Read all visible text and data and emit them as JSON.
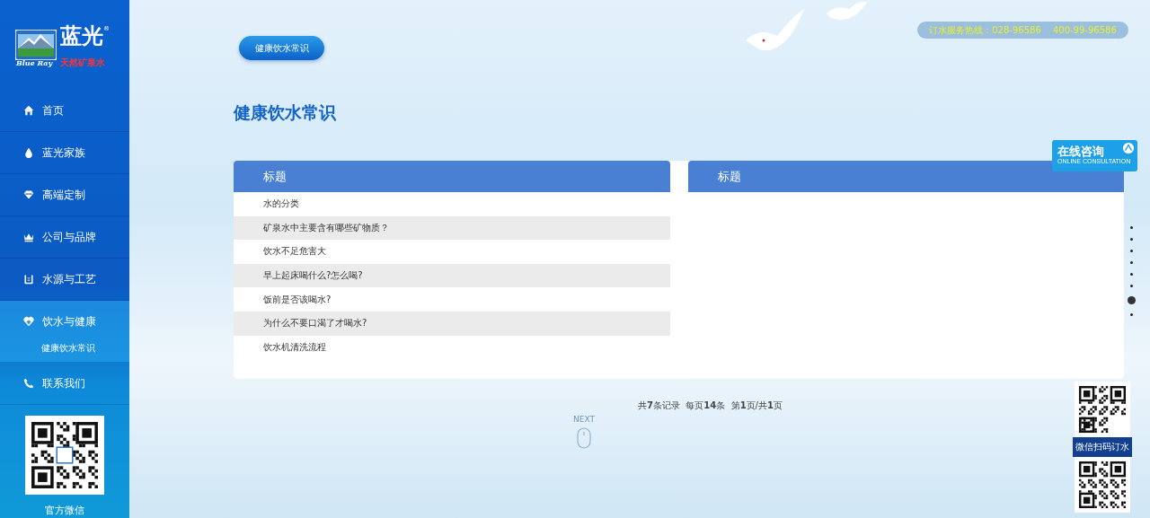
{
  "logo": {
    "brand": "蓝光",
    "brand_en": "Blue Ray",
    "tagline": "天然矿泉水",
    "registered": "®"
  },
  "sidebar": {
    "items": [
      {
        "label": "首页",
        "kind": "home",
        "selected": false
      },
      {
        "label": "蓝光家族",
        "kind": "drop",
        "selected": false
      },
      {
        "label": "高端定制",
        "kind": "diamond",
        "selected": false
      },
      {
        "label": "公司与品牌",
        "kind": "crown",
        "selected": false
      },
      {
        "label": "水源与工艺",
        "kind": "building",
        "selected": false
      },
      {
        "label": "饮水与健康",
        "kind": "heart",
        "selected": true,
        "children": [
          {
            "label": "健康饮水常识"
          }
        ]
      },
      {
        "label": "联系我们",
        "kind": "phone",
        "selected": false
      }
    ],
    "qr_caption": "官方微信"
  },
  "hotline": "订水服务热线：028-96586　 400-99-96586",
  "breadcrumb_button": "健康饮水常识",
  "page_title": "健康饮水常识",
  "list_panel": {
    "heading": "标题",
    "rows": [
      {
        "title": "水的分类"
      },
      {
        "title": "矿泉水中主要含有哪些矿物质？"
      },
      {
        "title": "饮水不足危害大"
      },
      {
        "title": "早上起床喝什么?怎么喝?"
      },
      {
        "title": "饭前是否该喝水?"
      },
      {
        "title": "为什么不要口渴了才喝水?"
      },
      {
        "title": "饮水机清洗流程"
      }
    ]
  },
  "detail_panel": {
    "heading": "标题"
  },
  "pagination": "共**7**条记录  每页**14**条  第**1**页/共**1**页",
  "scroll_hint": "NEXT",
  "online_consult": {
    "title": "在线咨询",
    "subtitle": "ONLINE CONSULTATION"
  },
  "page_dots": [
    {
      "selected": false
    },
    {
      "selected": false
    },
    {
      "selected": false
    },
    {
      "selected": false
    },
    {
      "selected": false
    },
    {
      "selected": false
    },
    {
      "selected": true
    },
    {
      "selected": false
    }
  ],
  "order_qr_caption": "微信扫码订水"
}
